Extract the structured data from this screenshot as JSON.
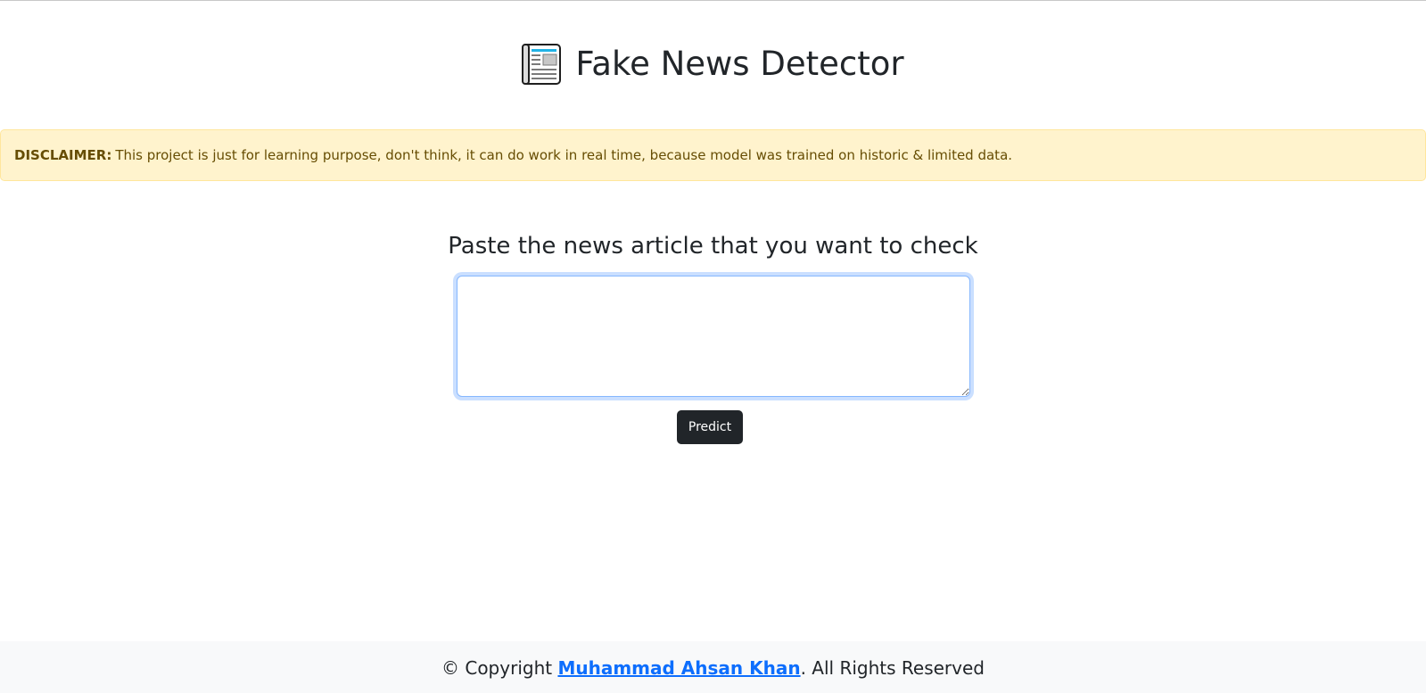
{
  "header": {
    "title": "Fake News Detector",
    "icon": "newspaper-icon"
  },
  "disclaimer": {
    "label": "DISCLAIMER:",
    "text": "This project is just for learning purpose, don't think, it can do work in real time, because model was trained on historic & limited data."
  },
  "form": {
    "heading": "Paste the news article that you want to check",
    "textarea_value": "",
    "predict_label": "Predict"
  },
  "footer": {
    "prefix": "© Copyright",
    "author": "Muhammad Ahsan Khan",
    "suffix": ". All Rights Reserved"
  },
  "colors": {
    "alert_bg": "#fff3cd",
    "alert_text": "#664d03",
    "button_bg": "#212529",
    "link": "#0d6efd",
    "footer_bg": "#f8f9fa"
  }
}
